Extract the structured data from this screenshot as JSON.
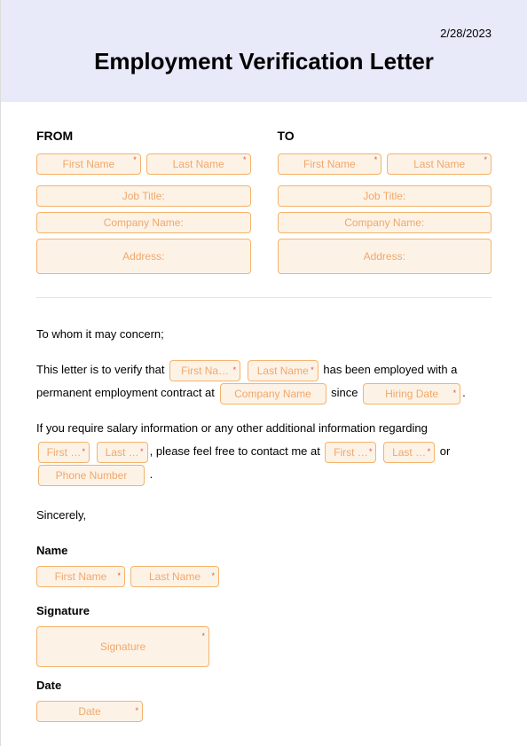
{
  "header": {
    "date": "2/28/2023",
    "title": "Employment Verification Letter"
  },
  "labels": {
    "from": "FROM",
    "to": "TO",
    "name": "Name",
    "signature": "Signature",
    "dateLabel": "Date"
  },
  "fields": {
    "firstName": "First Name",
    "lastName": "Last Name",
    "jobTitle": "Job Title:",
    "companyName": "Company Name:",
    "address": "Address:",
    "firstNaShort": "First Na…",
    "lastNameShort": "Last Name",
    "companyNameNoColon": "Company Name",
    "hiringDate": "Hiring Date",
    "firstShort": "First …",
    "lastShort": "Last …",
    "phoneNumber": "Phone Number",
    "signaturePh": "Signature",
    "datePh": "Date"
  },
  "body": {
    "greeting": "To whom it may concern;",
    "p1a": "This letter is to verify that ",
    "p1b": " has been employed with a permanent employment contract at ",
    "p1c": " since ",
    "p1d": ".",
    "p2a": "If you require salary information or any other additional information regarding",
    "p2b": ", please feel free to contact me at ",
    "p2c": " or",
    "p2d": " .",
    "closing": "Sincerely,"
  }
}
